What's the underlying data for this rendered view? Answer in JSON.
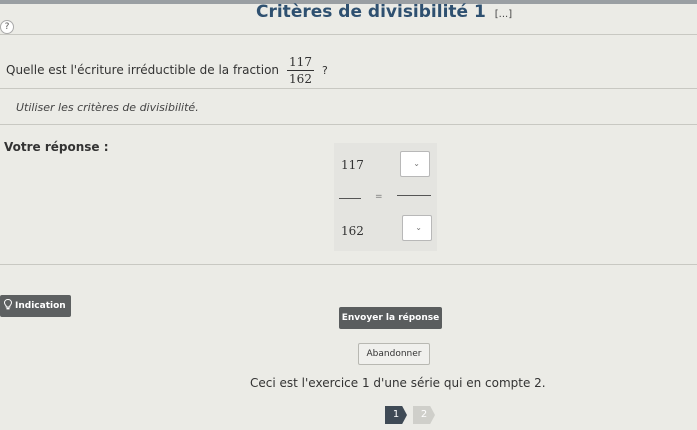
{
  "header": {
    "title": "Critères de divisibilité 1",
    "title_more": "[...]",
    "help_icon_glyph": "?"
  },
  "question": {
    "prompt": "Quelle est l'écriture irréductible de la fraction",
    "numerator": "117",
    "denominator": "162",
    "end_mark": "?"
  },
  "hint": {
    "text": "Utiliser les critères de divisibilité."
  },
  "answer": {
    "label": "Votre réponse :",
    "left_numerator": "117",
    "left_denominator": "162",
    "equals_sign": "=",
    "numerator_select": {
      "selected": "",
      "chevron": "⌄"
    },
    "denominator_select": {
      "selected": "",
      "chevron": "⌄"
    }
  },
  "buttons": {
    "indication": "Indication",
    "submit": "Envoyer la réponse",
    "abandon": "Abandonner"
  },
  "series": {
    "info": "Ceci est l'exercice 1 d'une série qui en compte 2.",
    "pages": [
      "1",
      "2"
    ],
    "current_page": 1
  },
  "colors": {
    "title": "#2e5070",
    "button_dark": "#5a5d5e",
    "background": "#ebebe6",
    "page_current": "#3f4a55"
  }
}
